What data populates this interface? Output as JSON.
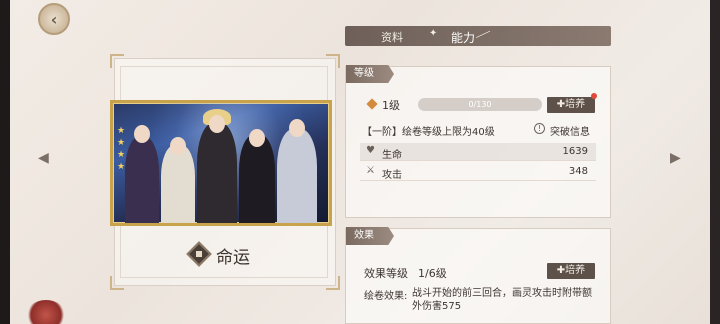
{
  "header": {
    "back_icon": "back-arrow-icon"
  },
  "tabs": [
    {
      "label": "资料",
      "active": false
    },
    {
      "label": "能力",
      "active": true
    }
  ],
  "card": {
    "title": "命运",
    "stars": [
      "★",
      "★",
      "★",
      "★"
    ]
  },
  "level_section": {
    "title": "等级",
    "level_label": "1级",
    "progress_text": "0/130",
    "progress_fraction": 0,
    "train_label": "✚培养",
    "limit_text": "【一阶】绘卷等级上限为40级",
    "breakthrough_label": "突破信息",
    "stats": [
      {
        "icon": "heart-icon",
        "glyph": "♥",
        "name": "生命",
        "value": "1639"
      },
      {
        "icon": "crossed-swords-icon",
        "glyph": "⚔",
        "name": "攻击",
        "value": "348"
      }
    ]
  },
  "effect_section": {
    "title": "效果",
    "level_label": "效果等级",
    "level_value": "1/6级",
    "train_label": "✚培养",
    "desc_label": "绘卷效果:",
    "desc_text": "战斗开始的前三回合，画灵攻击时附带额外伤害575"
  },
  "colors": {
    "accent_bar": "#6e6059",
    "button": "#5e514a",
    "gold_frame": "#c9a24c",
    "red_dot": "#e14a3a"
  }
}
